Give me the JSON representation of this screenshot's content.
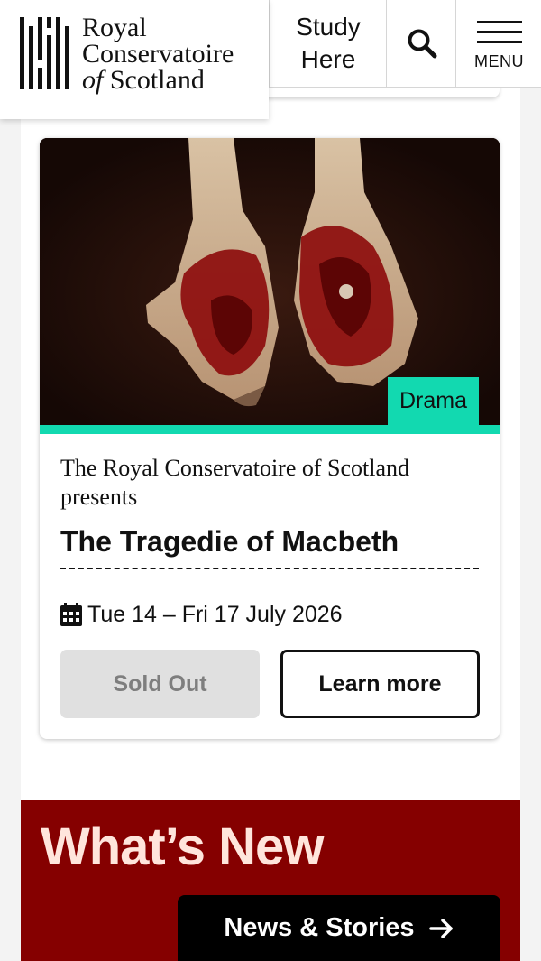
{
  "header": {
    "logo": {
      "line1": "Royal",
      "line2": "Conservatoire",
      "line3_of": "of",
      "line3_rest": " Scotland"
    },
    "study_here_line1": "Study",
    "study_here_line2": "Here",
    "search_icon": "search-icon",
    "menu_label": "MENU",
    "menu_icon": "hamburger-menu-icon"
  },
  "event_card": {
    "category_tag": "Drama",
    "presenter": "The Royal Conservatoire of Scotland presents",
    "title": "The Tragedie of Macbeth",
    "date_icon": "calendar-icon",
    "date": "Tue 14 – Fri 17 July 2026",
    "status_button": "Sold Out",
    "learn_more_button": "Learn more"
  },
  "whats_new": {
    "heading": "What’s New",
    "news_button": "News & Stories",
    "news_button_icon": "arrow-right-icon"
  },
  "colors": {
    "accent_teal": "#12d9b0",
    "whats_new_bg": "#850000",
    "whats_new_heading": "#ffe5dc",
    "sold_out_bg": "#e0e0e0"
  }
}
